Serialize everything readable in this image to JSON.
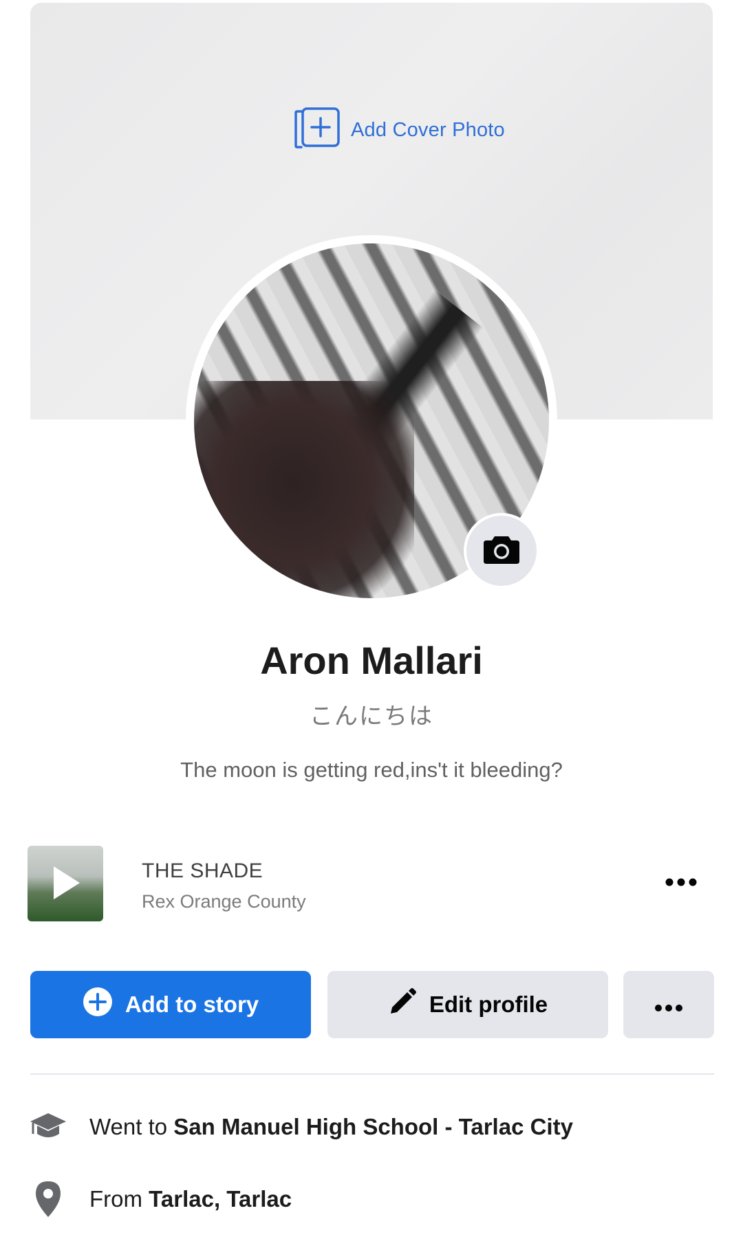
{
  "cover": {
    "add_label": "Add Cover Photo",
    "icon": "add-photo-icon",
    "accent": "#2f6fd6"
  },
  "profile": {
    "name": "Aron Mallari",
    "nickname": "こんにちは",
    "bio": "The moon is getting red,ins't it bleeding?",
    "camera_icon": "camera-icon"
  },
  "music": {
    "title": "THE SHADE",
    "artist": "Rex Orange County",
    "more_icon": "more-horizontal-icon"
  },
  "actions": {
    "add_story_label": "Add to story",
    "add_story_icon": "plus-circle-icon",
    "edit_profile_label": "Edit profile",
    "edit_profile_icon": "pencil-icon",
    "more_icon": "more-horizontal-icon",
    "primary_color": "#1b74e4",
    "secondary_color": "#e4e6eb"
  },
  "details": {
    "education_prefix": "Went to ",
    "education_value": "San Manuel High School - Tarlac City",
    "education_icon": "graduation-cap-icon",
    "from_prefix": "From ",
    "from_value": "Tarlac, Tarlac",
    "from_icon": "location-pin-icon"
  }
}
